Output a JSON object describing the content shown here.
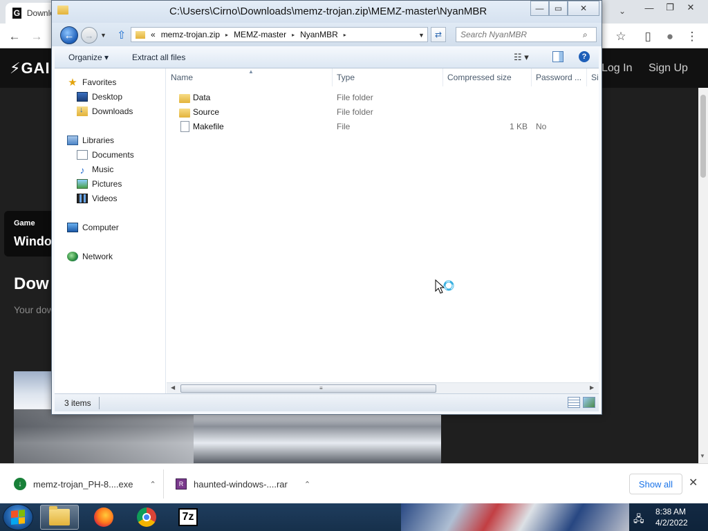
{
  "browser": {
    "tab_title": "Download Haunted Windows - Game",
    "favicon_glyph": "G",
    "new_tab_glyph": "⌄",
    "win_controls": [
      "—",
      "❐",
      "✕"
    ],
    "toolbar": {
      "back": "←",
      "forward": "→",
      "star": "☆",
      "sidebar": "▯",
      "profile": "●",
      "menu": "⋮"
    }
  },
  "site": {
    "logo": "⚡GAI",
    "log_in": "Log In",
    "sign_up": "Sign Up",
    "game_badge": "Game",
    "game_name_partial": "Windo",
    "page_title_partial": "Dow",
    "page_subtitle_partial": "Your dow"
  },
  "downloads": {
    "items": [
      {
        "name": "memz-trojan_PH-8....exe",
        "icon": "download-done-icon",
        "chevron": "⌃"
      },
      {
        "name": "haunted-windows-....rar",
        "icon": "rar-archive-icon",
        "chevron": "⌃"
      }
    ],
    "show_all": "Show all",
    "close": "✕"
  },
  "taskbar": {
    "apps": [
      "Windows Explorer",
      "Firefox",
      "Google Chrome",
      "7-Zip"
    ],
    "sevenz_label": "7z",
    "time": "8:38 AM",
    "date": "4/2/2022"
  },
  "explorer": {
    "title": "C:\\Users\\Cirno\\Downloads\\memz-trojan.zip\\MEMZ-master\\NyanMBR",
    "window_buttons": {
      "min": "—",
      "max": "▭",
      "close": "✕"
    },
    "address": {
      "prefix": "«",
      "crumbs": [
        "memz-trojan.zip",
        "MEMZ-master",
        "NyanMBR"
      ],
      "separator": "▸"
    },
    "search_placeholder": "Search NyanMBR",
    "commands": {
      "organize": "Organize ▾",
      "extract": "Extract all files",
      "views": "☷ ▾",
      "help": "?"
    },
    "nav_pane": {
      "favorites": "Favorites",
      "desktop": "Desktop",
      "downloads": "Downloads",
      "libraries": "Libraries",
      "documents": "Documents",
      "music": "Music",
      "pictures": "Pictures",
      "videos": "Videos",
      "computer": "Computer",
      "network": "Network"
    },
    "columns": [
      "Name",
      "Type",
      "Compressed size",
      "Password ...",
      "Si"
    ],
    "files": [
      {
        "name": "Data",
        "type": "File folder",
        "size": "",
        "password": "",
        "kind": "folder"
      },
      {
        "name": "Source",
        "type": "File folder",
        "size": "",
        "password": "",
        "kind": "folder"
      },
      {
        "name": "Makefile",
        "type": "File",
        "size": "1 KB",
        "password": "No",
        "kind": "file"
      }
    ],
    "status": "3 items"
  }
}
